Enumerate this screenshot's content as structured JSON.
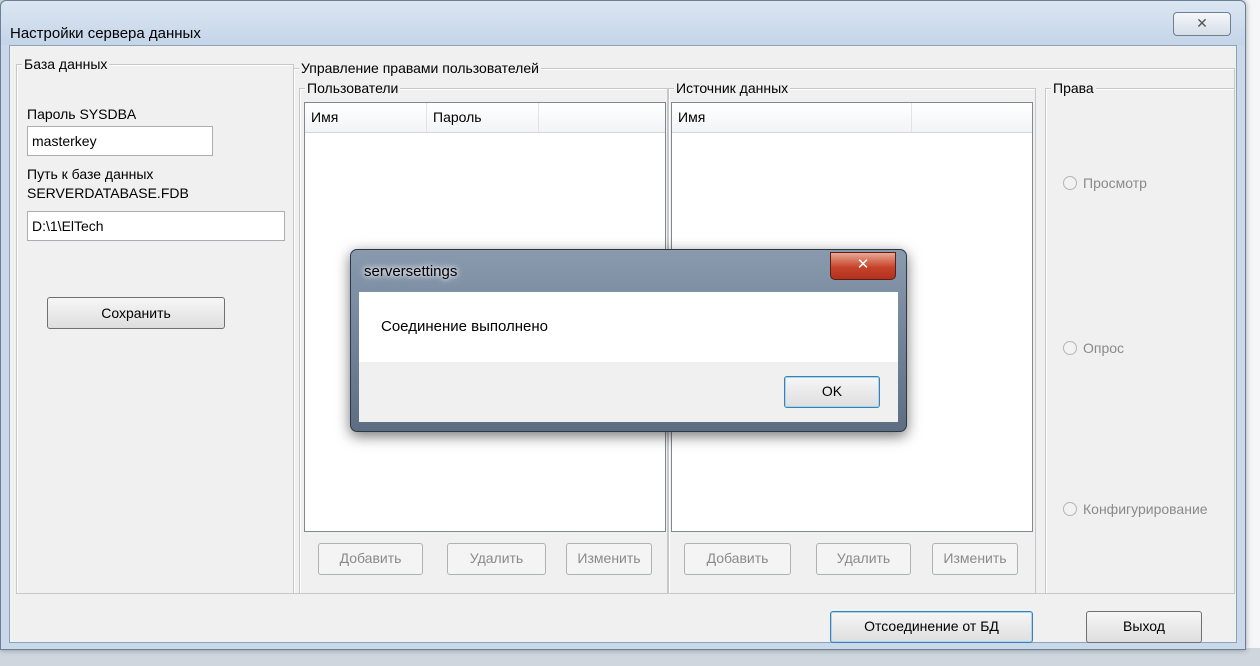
{
  "window": {
    "title": "Настройки сервера данных",
    "close_glyph": "✕"
  },
  "database": {
    "group_label": "База данных",
    "password_label": "Пароль SYSDBA",
    "password_value": "masterkey",
    "path_label": "Путь к базе данных",
    "db_file_label": "SERVERDATABASE.FDB",
    "path_value": "D:\\1\\ElTech",
    "save_label": "Сохранить"
  },
  "rights_management": {
    "group_label": "Управление правами пользователей",
    "users": {
      "group_label": "Пользователи",
      "columns": [
        "Имя",
        "Пароль",
        ""
      ],
      "add_label": "Добавить",
      "delete_label": "Удалить",
      "edit_label": "Изменить"
    },
    "data_source": {
      "group_label": "Источник данных",
      "columns": [
        "Имя",
        ""
      ],
      "add_label": "Добавить",
      "delete_label": "Удалить",
      "edit_label": "Изменить"
    },
    "rights": {
      "group_label": "Права",
      "options": [
        "Просмотр",
        "Опрос",
        "Конфигурирование"
      ]
    }
  },
  "footer": {
    "disconnect_label": "Отсоединение от БД",
    "exit_label": "Выход"
  },
  "dialog": {
    "title": "serversettings",
    "close_glyph": "✕",
    "message": "Соединение выполнено",
    "ok_label": "OK"
  },
  "colors": {
    "window_frame": "#c9d9ea",
    "client_bg": "#f0f0f0",
    "dialog_close": "#c6432a"
  }
}
